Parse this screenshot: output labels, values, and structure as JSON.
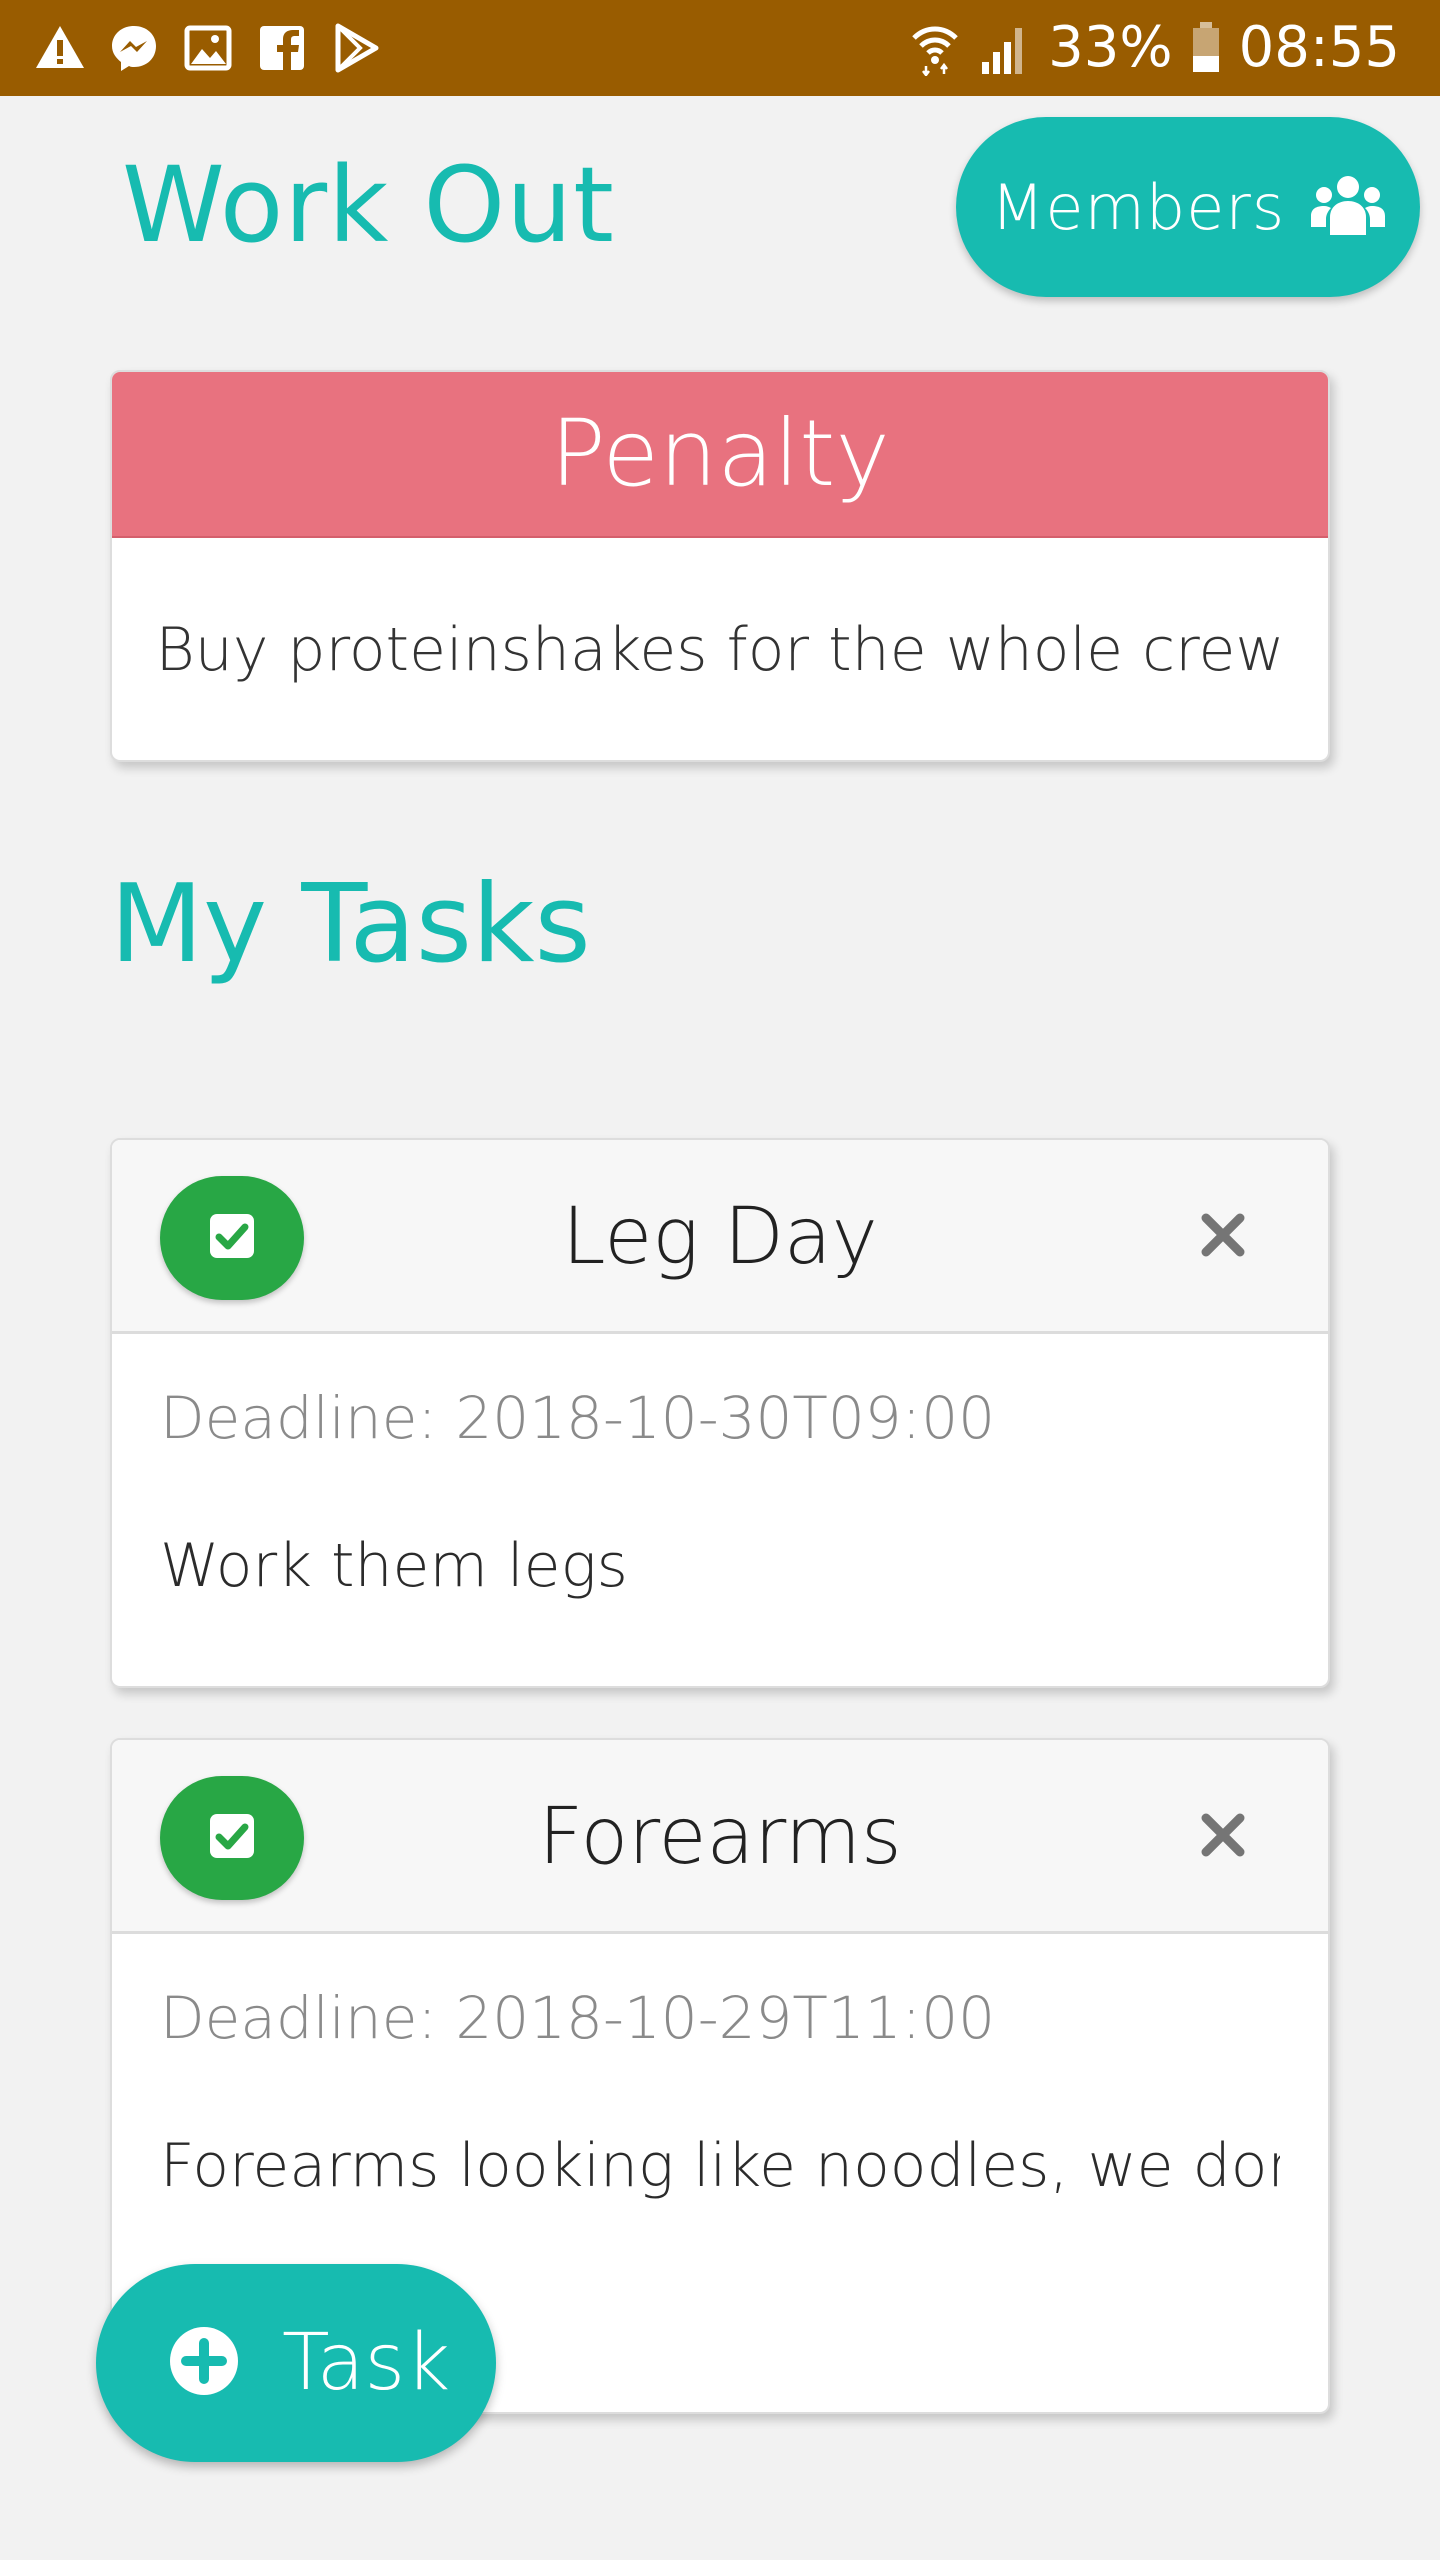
{
  "status_bar": {
    "battery": "33%",
    "time": "08:55"
  },
  "header": {
    "title": "Work Out",
    "members_label": "Members"
  },
  "penalty": {
    "heading": "Penalty",
    "text": "Buy proteinshakes for the whole crew"
  },
  "tasks_section": {
    "title": "My Tasks"
  },
  "tasks": [
    {
      "title": "Leg Day",
      "deadline": "Deadline: 2018-10-30T09:00",
      "description": "Work them legs"
    },
    {
      "title": "Forearms",
      "deadline": "Deadline: 2018-10-29T11:00",
      "description": "Forearms looking like noodles, we don't"
    }
  ],
  "add_task": {
    "label": "Task"
  },
  "colors": {
    "accent": "#17bbb0",
    "status_bar": "#995c00",
    "penalty_header": "#e8727f",
    "complete_button": "#28a745"
  },
  "icons": {
    "status_left": [
      "warning-icon",
      "messenger-icon",
      "image-icon",
      "facebook-icon",
      "play-store-icon"
    ],
    "status_right": [
      "wifi-icon",
      "signal-icon",
      "battery-icon"
    ],
    "members": "users-icon",
    "task_complete": "check-square-icon",
    "task_delete": "close-icon",
    "add_task": "plus-circle-icon"
  }
}
